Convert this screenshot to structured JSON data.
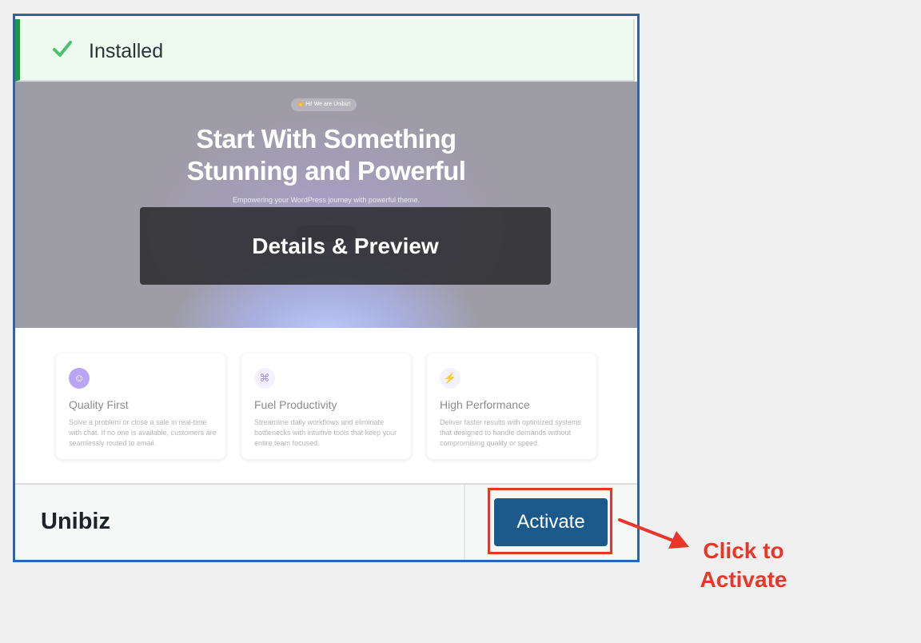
{
  "notice": {
    "text": "Installed"
  },
  "screenshot": {
    "badge": "👋 Hi! We are Unibiz!",
    "title_line1": "Start With Something",
    "title_line2": "Stunning and Powerful",
    "subtitle": "Empowering your WordPress journey with powerful theme.",
    "overlay_label": "Details & Preview",
    "features": [
      {
        "icon": "☺",
        "icon_name": "smile-icon",
        "title": "Quality First",
        "text": "Solve a problem or close a sale in real-time with chat. If no one is available, customers are seamlessly routed to email."
      },
      {
        "icon": "⌘",
        "icon_name": "command-icon",
        "title": "Fuel Productivity",
        "text": "Streamline daily workflows and eliminate bottlenecks with intuitive tools that keep your entire team focused."
      },
      {
        "icon": "⚡",
        "icon_name": "lightning-icon",
        "title": "High Performance",
        "text": "Deliver faster results with optimized systems that designed to handle demands without compromising quality or speed."
      }
    ]
  },
  "footer": {
    "theme_name": "Unibiz",
    "activate_label": "Activate"
  },
  "annotation": {
    "line1": "Click to",
    "line2": "Activate",
    "color": "#ea3528"
  },
  "colors": {
    "accent": "#2e64ad",
    "activate_button": "#1c5a8c",
    "success": "#1d9b3a"
  }
}
